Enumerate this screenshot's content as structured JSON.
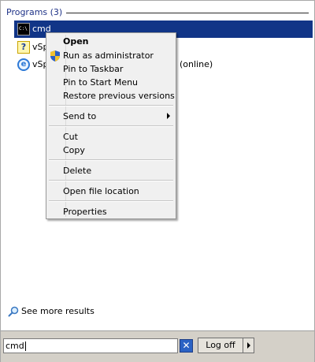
{
  "programs": {
    "header": "Programs (3)",
    "items": [
      {
        "label": "cmd",
        "icon": "command-prompt-icon",
        "selected": true
      },
      {
        "label": "vSp",
        "icon": "help-file-icon",
        "selected": false
      },
      {
        "label": "vSp",
        "icon": "internet-explorer-icon",
        "selected": false
      }
    ],
    "third_item_tail": "(online)"
  },
  "context_menu": {
    "items": [
      {
        "label": "Open",
        "bold": true
      },
      {
        "label": "Run as administrator",
        "icon": "uac-shield-icon"
      },
      {
        "label": "Pin to Taskbar"
      },
      {
        "label": "Pin to Start Menu"
      },
      {
        "label": "Restore previous versions"
      },
      {
        "label": "Send to",
        "submenu": true
      },
      {
        "label": "Cut"
      },
      {
        "label": "Copy"
      },
      {
        "label": "Delete"
      },
      {
        "label": "Open file location"
      },
      {
        "label": "Properties"
      }
    ]
  },
  "see_more": {
    "label": "See more results",
    "icon": "magnifier-icon"
  },
  "search": {
    "value": "cmd"
  },
  "logoff": {
    "label": "Log off"
  },
  "colors": {
    "selection": "#113587",
    "header_text": "#1e3287",
    "menu_bg": "#f0f0f0"
  }
}
